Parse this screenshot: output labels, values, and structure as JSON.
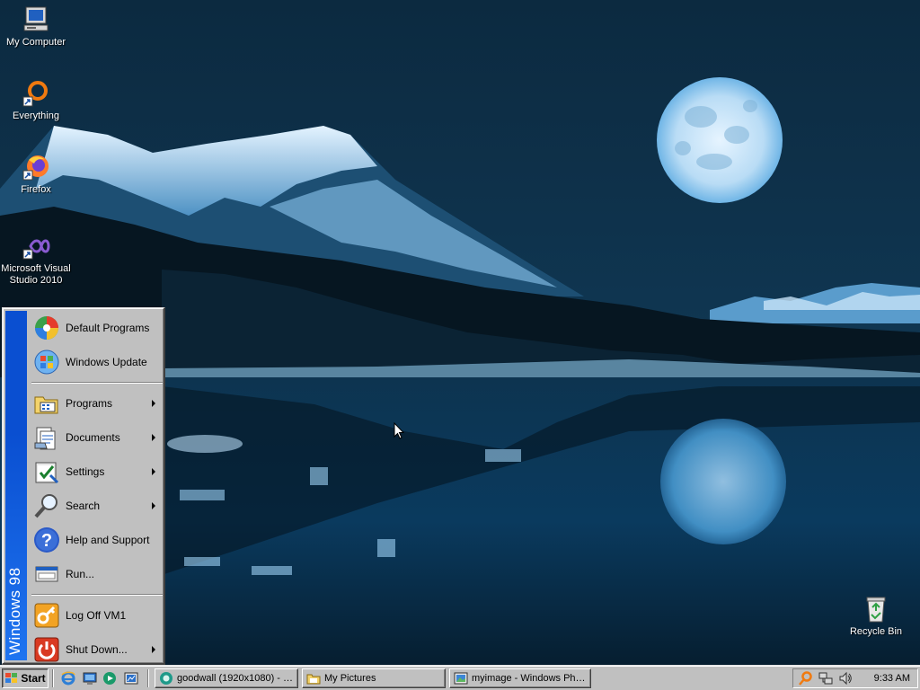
{
  "desktop": {
    "icons": [
      {
        "label": "My Computer",
        "icon": "my-computer-icon"
      },
      {
        "label": "Everything",
        "icon": "everything-search-icon"
      },
      {
        "label": "Firefox",
        "icon": "firefox-icon"
      },
      {
        "label": "Microsoft Visual Studio 2010",
        "icon": "visual-studio-icon"
      },
      {
        "label": "Recycle Bin",
        "icon": "recycle-bin-icon"
      }
    ]
  },
  "start_menu": {
    "banner": "Windows 98",
    "items": [
      {
        "label": "Default Programs",
        "icon": "default-programs-icon",
        "submenu": false
      },
      {
        "label": "Windows Update",
        "icon": "windows-update-icon",
        "submenu": false
      },
      {
        "label": "Programs",
        "icon": "programs-folder-icon",
        "submenu": true
      },
      {
        "label": "Documents",
        "icon": "documents-icon",
        "submenu": true
      },
      {
        "label": "Settings",
        "icon": "settings-icon",
        "submenu": true
      },
      {
        "label": "Search",
        "icon": "search-icon",
        "submenu": true
      },
      {
        "label": "Help and Support",
        "icon": "help-icon",
        "submenu": false
      },
      {
        "label": "Run...",
        "icon": "run-icon",
        "submenu": false
      },
      {
        "label": "Log Off VM1",
        "icon": "log-off-icon",
        "submenu": false
      },
      {
        "label": "Shut Down...",
        "icon": "shut-down-icon",
        "submenu": true
      }
    ]
  },
  "taskbar": {
    "start_label": "Start",
    "quick_launch": [
      "internet-explorer-icon",
      "show-desktop-icon",
      "media-player-icon",
      "channels-icon"
    ],
    "tasks": [
      {
        "label": "goodwall (1920x1080) - S...",
        "icon": "image-viewer-icon",
        "active": false
      },
      {
        "label": "My Pictures",
        "icon": "folder-icon",
        "active": false
      },
      {
        "label": "myimage - Windows Phot...",
        "icon": "photo-viewer-icon",
        "active": false
      }
    ],
    "tray": {
      "icons": [
        "search-tray-icon",
        "network-tray-icon",
        "volume-icon"
      ],
      "clock": "9:33 AM"
    }
  },
  "colors": {
    "banner_blue": "#0a4fd1",
    "face": "#c0c0c0",
    "night_sky": "#0b2a3f"
  }
}
